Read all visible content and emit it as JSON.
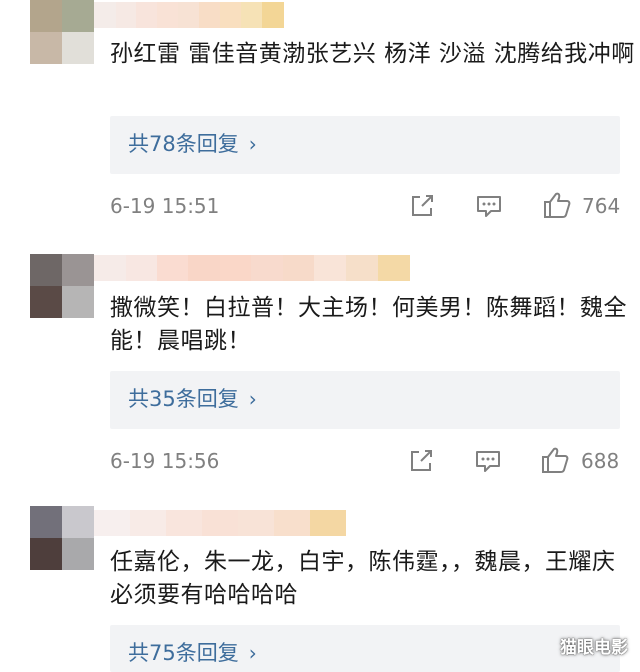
{
  "comments": [
    {
      "text": "孙红雷 雷佳音黄渤张艺兴 杨洋 沙溢 沈腾给我冲啊",
      "reply_label": "共78条回复",
      "time": "6-19 15:51",
      "likes": "764",
      "avatar_colors": [
        "#b3a58c",
        "#a6aa93",
        "#c8b8a7",
        "#e1dfd9"
      ],
      "name_colors": [
        "#f4ece9",
        "#f6e9e4",
        "#f8e4dc",
        "#f9e2d6",
        "#f7e2d4",
        "#f8ddc6",
        "#f9dfbf",
        "#f6e2b6",
        "#f3d696"
      ]
    },
    {
      "text": "撒微笑！白拉普！大主场！何美男！陈舞蹈！魏全能！晨唱跳！",
      "reply_label": "共35条回复",
      "time": "6-19 15:56",
      "likes": "688",
      "avatar_colors": [
        "#6e6766",
        "#9a9494",
        "#5a4a46",
        "#b6b5b5"
      ],
      "name_colors": [
        "#f6ebe8",
        "#f8e7e2",
        "#fadcd1",
        "#f9d6c7",
        "#fad7c8",
        "#f8dacd",
        "#f7dac9",
        "#f9e4d8",
        "#f6dfc9",
        "#f4d9a6"
      ]
    },
    {
      "text": "任嘉伦，朱一龙，白宇，陈伟霆，，魏晨，王耀庆必须要有哈哈哈哈",
      "reply_label": "共75条回复",
      "avatar_colors": [
        "#72707a",
        "#c9c8cd",
        "#4e3e3c",
        "#a9a9ab"
      ],
      "name_colors": [
        "#f7efee",
        "#f8ebe7",
        "#f9e5dd",
        "#f9e1d6",
        "#f8e3d7",
        "#f8dfcc",
        "#f4d7a3"
      ]
    }
  ],
  "icons": {
    "share": "share-icon",
    "comment": "comment-icon",
    "like": "thumbs-up-icon"
  },
  "colors": {
    "link": "#3e6d9c",
    "meta": "#808080",
    "reply_bg": "#f2f3f5"
  },
  "watermark": "猫眼电影"
}
